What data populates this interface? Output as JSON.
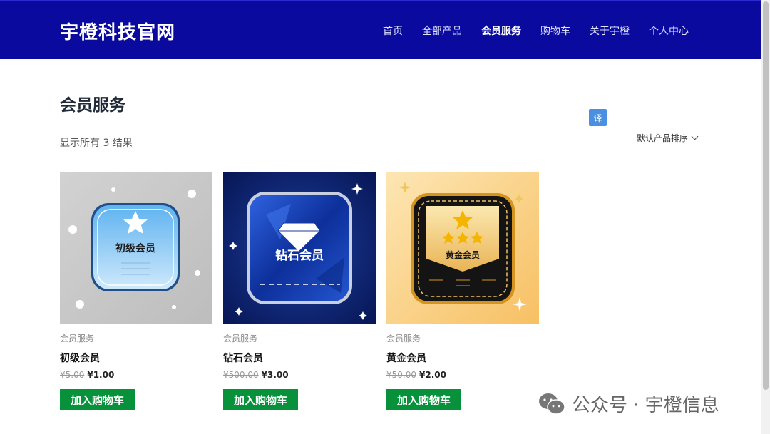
{
  "header": {
    "site_title": "宇橙科技官网",
    "nav": [
      "首页",
      "全部产品",
      "会员服务",
      "购物车",
      "关于宇橙",
      "个人中心"
    ],
    "active_index": 2,
    "bg_color": "#0a0a9e"
  },
  "main": {
    "title": "会员服务",
    "results_text": "显示所有 3 结果",
    "translate_label": "译",
    "sort_label": "默认产品排序"
  },
  "products": [
    {
      "category": "会员服务",
      "name": "初级会员",
      "old_price": "¥5.00",
      "price": "¥1.00",
      "button": "加入购物车",
      "badge_text": "初级会员"
    },
    {
      "category": "会员服务",
      "name": "钻石会员",
      "old_price": "¥500.00",
      "price": "¥3.00",
      "button": "加入购物车",
      "badge_text": "钻石会员"
    },
    {
      "category": "会员服务",
      "name": "黄金会员",
      "old_price": "¥50.00",
      "price": "¥2.00",
      "button": "加入购物车",
      "badge_text": "黄金会员"
    }
  ],
  "watermark": "公众号 · 宇橙信息",
  "colors": {
    "button": "#07913a",
    "translate": "#4a90e2"
  }
}
